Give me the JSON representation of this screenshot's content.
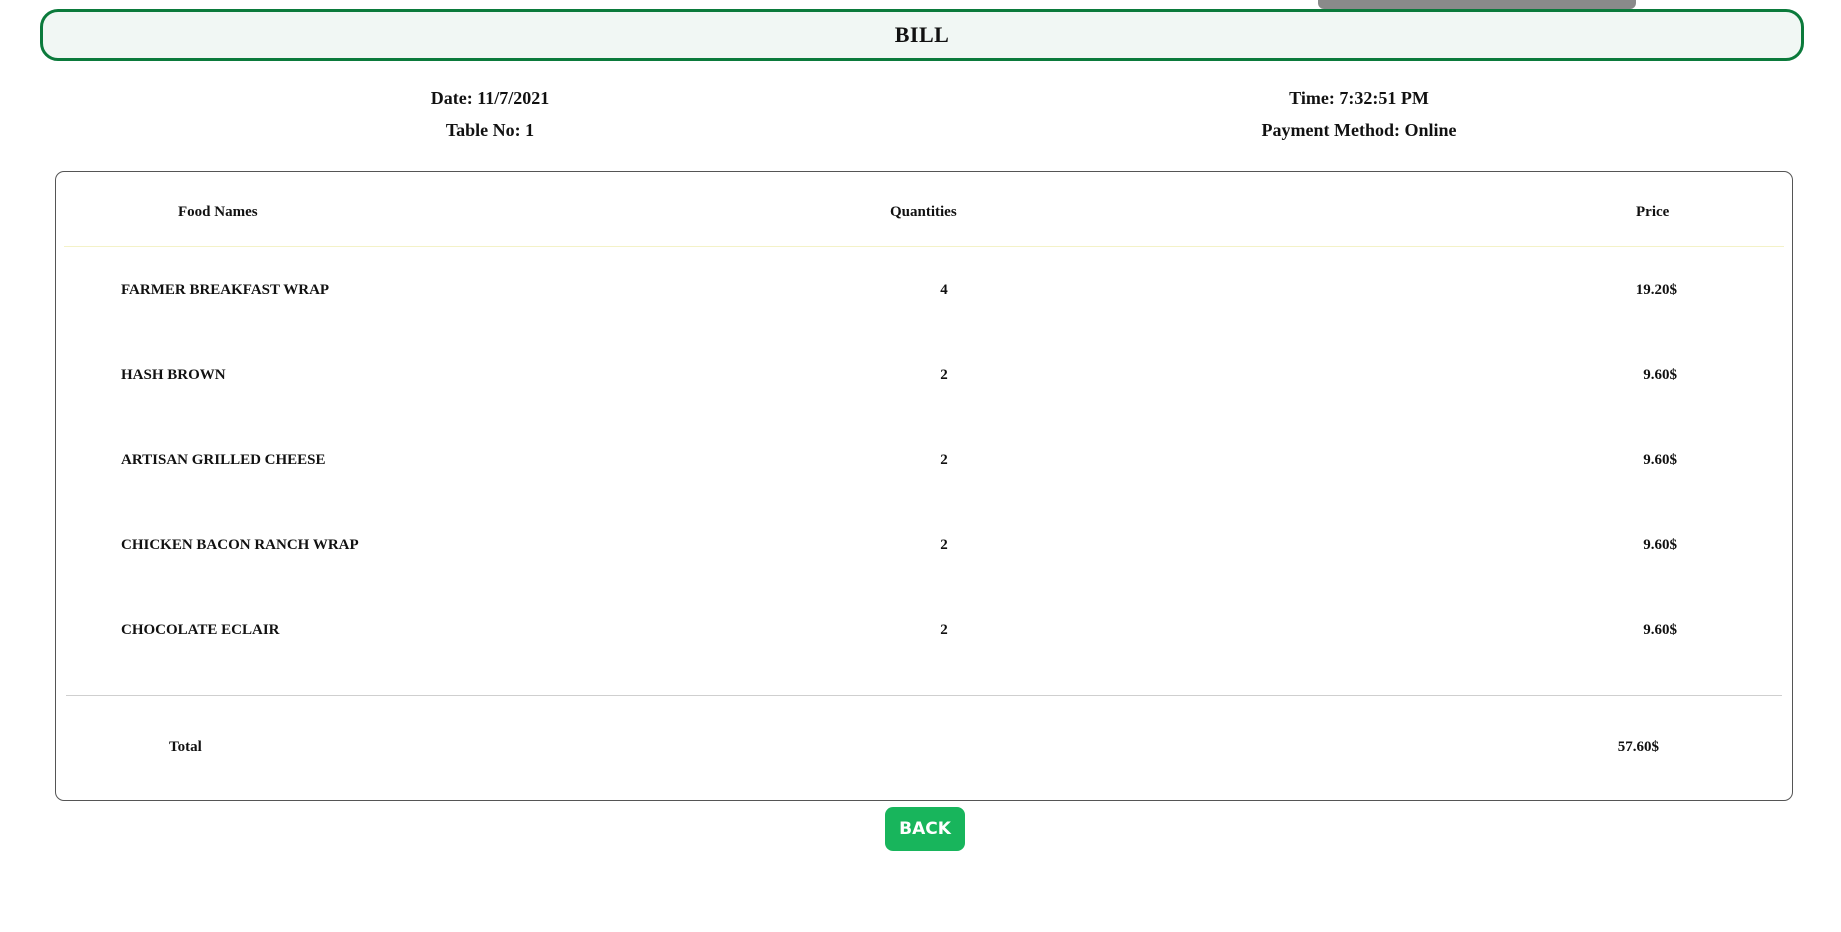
{
  "header": {
    "title": "BILL"
  },
  "meta": {
    "date": "Date: 11/7/2021",
    "table_no": "Table No: 1",
    "time": "Time: 7:32:51 PM",
    "payment_method": "Payment Method: Online"
  },
  "table": {
    "columns": [
      "Food Names",
      "Quantities",
      "Price"
    ],
    "rows": [
      {
        "name": "FARMER BREAKFAST WRAP",
        "quantity": "4",
        "price": "19.20$"
      },
      {
        "name": "HASH BROWN",
        "quantity": "2",
        "price": "9.60$"
      },
      {
        "name": "ARTISAN GRILLED CHEESE",
        "quantity": "2",
        "price": "9.60$"
      },
      {
        "name": "CHICKEN BACON RANCH WRAP",
        "quantity": "2",
        "price": "9.60$"
      },
      {
        "name": "CHOCOLATE ECLAIR",
        "quantity": "2",
        "price": "9.60$"
      }
    ],
    "total_label": "Total",
    "total_value": "57.60$"
  },
  "actions": {
    "back_label": "BACK"
  },
  "colors": {
    "header_border": "#0b7a3b",
    "header_background": "#f1f7f4",
    "back_button": "#18b55c"
  }
}
